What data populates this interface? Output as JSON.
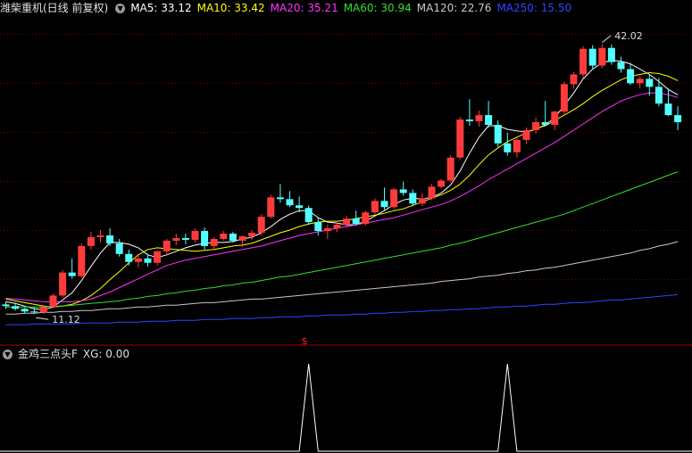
{
  "header": {
    "title": "潍柴重机(日线 前复权)",
    "indicators": [
      {
        "label": "MA5: 33.12",
        "color": "#ffffff"
      },
      {
        "label": "MA10: 33.42",
        "color": "#ffff00"
      },
      {
        "label": "MA20: 35.21",
        "color": "#ff33ff"
      },
      {
        "label": "MA60: 30.94",
        "color": "#33dd33"
      },
      {
        "label": "MA120: 22.76",
        "color": "#c8c8c8"
      },
      {
        "label": "MA250: 15.50",
        "color": "#3344ff"
      }
    ]
  },
  "sub_header": {
    "title": "金鸡三点头F",
    "value_label": "XG: 0.00"
  },
  "markers": {
    "high_label": "42.02",
    "low_label": "11.12",
    "signal_symbol": "$"
  },
  "colors": {
    "up": "#ff3b3b",
    "down": "#54ffff",
    "grid": "#7a0000",
    "signal": "#ffffff"
  },
  "chart_data": {
    "type": "candlestick",
    "y_range": [
      8.5,
      45.0
    ],
    "candles": [
      [
        12.6,
        12.9,
        12.1,
        12.4
      ],
      [
        12.4,
        12.8,
        11.9,
        12.1
      ],
      [
        12.1,
        12.2,
        11.6,
        11.8
      ],
      [
        11.8,
        12.3,
        11.5,
        11.7
      ],
      [
        11.7,
        12.5,
        11.5,
        12.3
      ],
      [
        12.3,
        13.8,
        12.2,
        13.6
      ],
      [
        13.6,
        16.5,
        13.4,
        16.2
      ],
      [
        16.2,
        17.8,
        15.5,
        15.8
      ],
      [
        15.8,
        19.5,
        15.6,
        19.2
      ],
      [
        19.2,
        20.8,
        18.8,
        20.2
      ],
      [
        20.2,
        21.0,
        19.6,
        20.4
      ],
      [
        20.4,
        21.2,
        19.2,
        19.5
      ],
      [
        19.5,
        20.0,
        18.0,
        18.3
      ],
      [
        18.3,
        18.8,
        17.0,
        17.4
      ],
      [
        17.4,
        18.2,
        16.8,
        17.8
      ],
      [
        17.8,
        18.3,
        16.9,
        17.3
      ],
      [
        17.3,
        18.7,
        17.0,
        18.6
      ],
      [
        18.6,
        20.0,
        18.2,
        19.8
      ],
      [
        19.8,
        20.6,
        19.3,
        20.1
      ],
      [
        20.1,
        20.6,
        19.4,
        19.9
      ],
      [
        19.9,
        21.2,
        19.6,
        20.9
      ],
      [
        20.9,
        21.3,
        18.8,
        19.2
      ],
      [
        19.2,
        20.2,
        18.9,
        20.0
      ],
      [
        20.0,
        20.9,
        19.8,
        20.6
      ],
      [
        20.6,
        20.8,
        19.6,
        19.8
      ],
      [
        19.8,
        20.4,
        19.1,
        20.3
      ],
      [
        20.3,
        21.0,
        19.9,
        20.7
      ],
      [
        20.7,
        22.8,
        20.4,
        22.5
      ],
      [
        22.5,
        25.0,
        22.3,
        24.7
      ],
      [
        24.7,
        26.2,
        24.1,
        24.5
      ],
      [
        24.5,
        25.4,
        23.6,
        23.8
      ],
      [
        23.8,
        24.8,
        23.0,
        23.5
      ],
      [
        23.5,
        23.8,
        21.6,
        21.9
      ],
      [
        21.9,
        22.4,
        20.4,
        20.9
      ],
      [
        20.9,
        21.6,
        20.0,
        21.2
      ],
      [
        21.2,
        21.8,
        20.8,
        21.6
      ],
      [
        21.6,
        22.6,
        21.4,
        22.3
      ],
      [
        22.3,
        23.2,
        21.5,
        21.7
      ],
      [
        21.7,
        23.2,
        21.5,
        23.0
      ],
      [
        23.0,
        24.6,
        22.8,
        24.3
      ],
      [
        24.3,
        25.8,
        23.3,
        23.6
      ],
      [
        23.6,
        25.8,
        23.4,
        25.6
      ],
      [
        25.6,
        26.5,
        24.9,
        25.2
      ],
      [
        25.2,
        25.6,
        23.7,
        24.0
      ],
      [
        24.0,
        25.2,
        23.7,
        24.6
      ],
      [
        24.6,
        26.2,
        24.4,
        25.9
      ],
      [
        25.9,
        26.8,
        25.7,
        26.6
      ],
      [
        26.6,
        29.5,
        26.4,
        29.2
      ],
      [
        29.2,
        33.8,
        29.0,
        33.5
      ],
      [
        33.5,
        35.8,
        32.8,
        33.3
      ],
      [
        33.3,
        34.5,
        32.7,
        34.0
      ],
      [
        34.0,
        35.6,
        32.6,
        32.9
      ],
      [
        32.9,
        33.4,
        30.4,
        30.8
      ],
      [
        30.8,
        32.0,
        29.4,
        29.8
      ],
      [
        29.8,
        31.5,
        29.2,
        31.2
      ],
      [
        31.2,
        32.6,
        30.8,
        32.3
      ],
      [
        32.3,
        33.7,
        31.9,
        33.2
      ],
      [
        33.2,
        35.6,
        32.8,
        32.9
      ],
      [
        32.9,
        34.5,
        32.3,
        34.4
      ],
      [
        34.4,
        37.8,
        34.0,
        37.5
      ],
      [
        37.5,
        38.9,
        37.0,
        38.6
      ],
      [
        38.6,
        41.8,
        38.2,
        41.5
      ],
      [
        41.5,
        41.9,
        39.2,
        39.6
      ],
      [
        39.6,
        42.0,
        39.3,
        41.6
      ],
      [
        41.6,
        42.0,
        39.7,
        40.0
      ],
      [
        40.0,
        40.6,
        38.8,
        39.2
      ],
      [
        39.2,
        39.8,
        37.4,
        37.6
      ],
      [
        37.6,
        38.4,
        37.0,
        38.1
      ],
      [
        38.1,
        38.6,
        36.2,
        37.2
      ],
      [
        37.2,
        38.2,
        35.0,
        35.3
      ],
      [
        35.3,
        37.0,
        33.9,
        34.0
      ],
      [
        34.0,
        35.0,
        32.3,
        33.2
      ]
    ],
    "series": [
      {
        "name": "MA5",
        "color": "#ffffff",
        "values": [
          12.9,
          12.7,
          12.4,
          12.1,
          12.0,
          12.3,
          13.1,
          13.9,
          15.3,
          16.9,
          18.4,
          19.6,
          19.6,
          19.4,
          19.0,
          18.2,
          17.9,
          18.2,
          18.6,
          19.0,
          19.3,
          19.5,
          19.6,
          19.6,
          19.7,
          20.0,
          20.2,
          20.7,
          21.4,
          22.2,
          22.8,
          23.2,
          23.2,
          22.4,
          21.9,
          21.8,
          21.6,
          21.6,
          22.0,
          22.6,
          23.2,
          23.9,
          24.4,
          24.6,
          24.5,
          24.7,
          25.2,
          26.1,
          27.7,
          29.7,
          31.5,
          32.8,
          32.8,
          32.4,
          32.2,
          32.1,
          32.4,
          32.9,
          33.7,
          35.1,
          36.5,
          38.1,
          39.2,
          39.9,
          40.2,
          40.1,
          39.8,
          39.2,
          38.6,
          37.8,
          36.9,
          36.3
        ]
      },
      {
        "name": "MA10",
        "color": "#ffff00",
        "values": [
          13.2,
          13.0,
          12.8,
          12.6,
          12.4,
          12.3,
          12.4,
          12.6,
          13.0,
          13.6,
          14.4,
          15.4,
          16.3,
          17.3,
          18.2,
          18.8,
          19.0,
          18.9,
          18.8,
          18.7,
          18.6,
          18.7,
          18.8,
          19.0,
          19.2,
          19.3,
          19.5,
          19.9,
          20.3,
          20.7,
          21.0,
          21.4,
          21.7,
          21.9,
          22.0,
          22.0,
          22.1,
          22.3,
          22.5,
          22.7,
          22.9,
          23.2,
          23.4,
          23.8,
          24.2,
          24.6,
          25.0,
          25.5,
          26.2,
          27.2,
          28.4,
          29.5,
          30.3,
          31.0,
          31.5,
          32.0,
          32.5,
          32.8,
          33.4,
          34.0,
          34.6,
          35.3,
          36.1,
          36.8,
          37.4,
          38.0,
          38.4,
          38.6,
          38.8,
          38.7,
          38.4,
          37.9
        ]
      },
      {
        "name": "MA20",
        "color": "#ff33ff",
        "values": [
          13.3,
          13.2,
          13.1,
          13.0,
          12.9,
          12.9,
          12.9,
          12.9,
          13.0,
          13.2,
          13.6,
          14.0,
          14.5,
          15.0,
          15.5,
          16.0,
          16.5,
          17.0,
          17.3,
          17.6,
          17.8,
          18.0,
          18.2,
          18.4,
          18.6,
          18.8,
          19.0,
          19.2,
          19.5,
          19.8,
          20.1,
          20.4,
          20.6,
          20.8,
          21.0,
          21.2,
          21.4,
          21.6,
          21.8,
          22.0,
          22.2,
          22.4,
          22.7,
          23.0,
          23.3,
          23.6,
          23.9,
          24.3,
          24.8,
          25.4,
          26.0,
          26.7,
          27.3,
          27.9,
          28.5,
          29.1,
          29.7,
          30.3,
          30.9,
          31.6,
          32.3,
          33.0,
          33.7,
          34.4,
          35.0,
          35.6,
          36.0,
          36.3,
          36.5,
          36.5,
          36.3,
          36.0
        ]
      },
      {
        "name": "MA60",
        "color": "#33dd33",
        "values": [
          12.3,
          12.3,
          12.3,
          12.3,
          12.3,
          12.4,
          12.4,
          12.5,
          12.6,
          12.7,
          12.8,
          12.9,
          13.0,
          13.2,
          13.3,
          13.5,
          13.6,
          13.8,
          13.9,
          14.1,
          14.2,
          14.4,
          14.5,
          14.7,
          14.8,
          15.0,
          15.1,
          15.3,
          15.5,
          15.7,
          15.8,
          16.0,
          16.2,
          16.4,
          16.6,
          16.8,
          17.0,
          17.2,
          17.4,
          17.6,
          17.8,
          18.0,
          18.2,
          18.4,
          18.6,
          18.8,
          19.0,
          19.3,
          19.5,
          19.8,
          20.1,
          20.4,
          20.7,
          21.0,
          21.3,
          21.6,
          21.9,
          22.2,
          22.5,
          22.8,
          23.2,
          23.6,
          24.0,
          24.4,
          24.8,
          25.2,
          25.6,
          26.0,
          26.4,
          26.8,
          27.2,
          27.6
        ]
      },
      {
        "name": "MA120",
        "color": "#c8c8c8",
        "values": [
          11.5,
          11.5,
          11.6,
          11.6,
          11.7,
          11.7,
          11.8,
          11.8,
          11.9,
          11.9,
          12.0,
          12.1,
          12.1,
          12.2,
          12.3,
          12.3,
          12.4,
          12.5,
          12.5,
          12.6,
          12.7,
          12.8,
          12.8,
          12.9,
          13.0,
          13.1,
          13.2,
          13.2,
          13.3,
          13.4,
          13.5,
          13.6,
          13.7,
          13.8,
          13.9,
          14.0,
          14.1,
          14.2,
          14.3,
          14.4,
          14.5,
          14.6,
          14.7,
          14.8,
          14.9,
          15.0,
          15.2,
          15.3,
          15.4,
          15.5,
          15.7,
          15.8,
          15.9,
          16.1,
          16.2,
          16.4,
          16.5,
          16.7,
          16.8,
          17.0,
          17.2,
          17.4,
          17.6,
          17.8,
          18.0,
          18.2,
          18.4,
          18.7,
          18.9,
          19.2,
          19.4,
          19.7
        ]
      },
      {
        "name": "MA250",
        "color": "#3344ff",
        "values": [
          10.3,
          10.3,
          10.3,
          10.4,
          10.4,
          10.4,
          10.4,
          10.4,
          10.5,
          10.5,
          10.5,
          10.5,
          10.6,
          10.6,
          10.6,
          10.7,
          10.7,
          10.7,
          10.8,
          10.8,
          10.8,
          10.9,
          10.9,
          10.9,
          11.0,
          11.0,
          11.0,
          11.1,
          11.1,
          11.2,
          11.2,
          11.2,
          11.3,
          11.3,
          11.4,
          11.4,
          11.4,
          11.5,
          11.5,
          11.6,
          11.6,
          11.7,
          11.7,
          11.8,
          11.8,
          11.9,
          11.9,
          12.0,
          12.0,
          12.1,
          12.1,
          12.2,
          12.3,
          12.3,
          12.4,
          12.4,
          12.5,
          12.6,
          12.6,
          12.7,
          12.8,
          12.8,
          12.9,
          13.0,
          13.1,
          13.1,
          13.2,
          13.3,
          13.4,
          13.5,
          13.6,
          13.7
        ]
      }
    ],
    "signal": {
      "name": "XG",
      "values": [
        0,
        0,
        0,
        0,
        0,
        0,
        0,
        0,
        0,
        0,
        0,
        0,
        0,
        0,
        0,
        0,
        0,
        0,
        0,
        0,
        0,
        0,
        0,
        0,
        0,
        0,
        0,
        0,
        0,
        0,
        0,
        0,
        1,
        0,
        0,
        0,
        0,
        0,
        0,
        0,
        0,
        0,
        0,
        0,
        0,
        0,
        0,
        0,
        0,
        0,
        0,
        0,
        0,
        1,
        0,
        0,
        0,
        0,
        0,
        0,
        0,
        0,
        0,
        0,
        0,
        0,
        0,
        0,
        0,
        0,
        0,
        0
      ],
      "y_range": [
        0,
        1
      ]
    }
  }
}
